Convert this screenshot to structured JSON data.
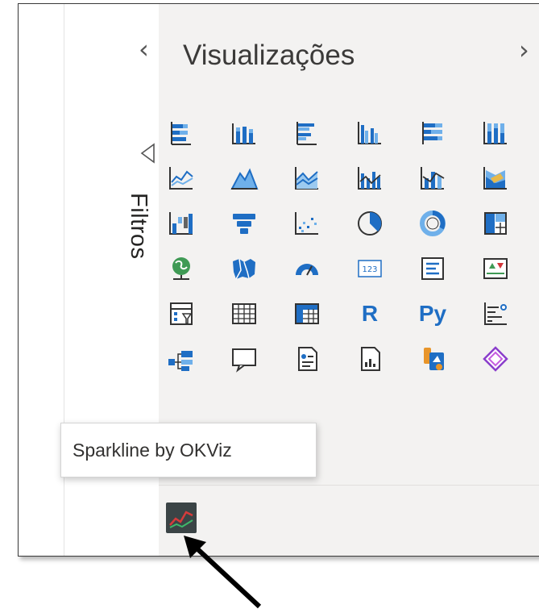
{
  "filters": {
    "label": "Filtros",
    "collapse_icon": "chevron-left-icon",
    "filter_icon": "filter-icon"
  },
  "visualizations": {
    "title": "Visualizações",
    "expand_icon": "chevron-right-icon",
    "rows": [
      [
        "stacked-bar-chart-icon",
        "stacked-column-chart-icon",
        "clustered-bar-chart-icon",
        "clustered-column-chart-icon",
        "100-stacked-bar-chart-icon",
        "100-stacked-column-chart-icon"
      ],
      [
        "line-chart-icon",
        "area-chart-icon",
        "stacked-area-chart-icon",
        "line-clustered-column-chart-icon",
        "line-stacked-column-chart-icon",
        "ribbon-chart-icon"
      ],
      [
        "waterfall-chart-icon",
        "funnel-icon",
        "scatter-chart-icon",
        "pie-chart-icon",
        "donut-chart-icon",
        "treemap-icon"
      ],
      [
        "map-icon",
        "filled-map-icon",
        "gauge-icon",
        "card-icon",
        "multi-row-card-icon",
        "kpi-icon"
      ],
      [
        "slicer-icon",
        "table-icon",
        "matrix-icon",
        "r-script-visual-icon",
        "python-visual-icon",
        "key-influencers-icon"
      ],
      [
        "decomposition-tree-icon",
        "qa-icon",
        "smart-narrative-icon",
        "paginated-report-icon",
        "power-apps-icon",
        "power-automate-icon"
      ]
    ],
    "r_label": "R",
    "py_label": "Py",
    "card_number": "123",
    "custom_visual_icon": "sparkline-icon"
  },
  "tooltip": {
    "text": "Sparkline by OKViz"
  },
  "colors": {
    "accent": "#1f6ec4",
    "light_accent": "#6fb0ea",
    "pane": "#f3f2f1"
  }
}
